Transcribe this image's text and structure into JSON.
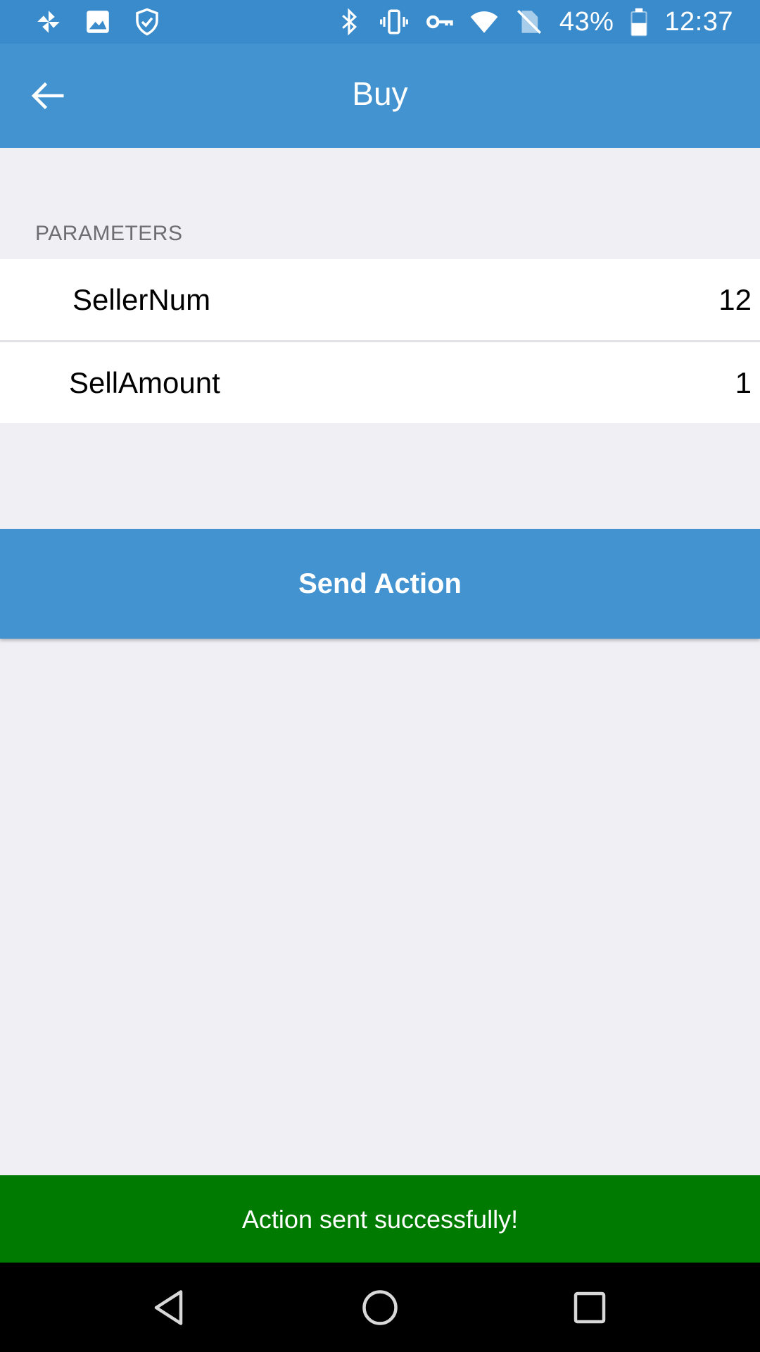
{
  "status_bar": {
    "battery_percent": "43%",
    "time": "12:37",
    "left_icons": [
      "pinwheel-icon",
      "image-icon",
      "shield-check-icon"
    ],
    "right_icons": [
      "bluetooth-icon",
      "vibrate-icon",
      "vpn-key-icon",
      "wifi-icon",
      "no-sim-icon",
      "battery-icon"
    ]
  },
  "toolbar": {
    "title": "Buy",
    "back_icon": "arrow-left-icon"
  },
  "parameters": {
    "header": "PARAMETERS",
    "items": [
      {
        "label": "SellerNum",
        "value": "12"
      },
      {
        "label": "SellAmount",
        "value": "1"
      }
    ]
  },
  "action": {
    "send_label": "Send Action"
  },
  "toast": {
    "message": "Action sent successfully!"
  },
  "nav_bar": {
    "icons": [
      "nav-back-icon",
      "nav-home-icon",
      "nav-recents-icon"
    ]
  },
  "colors": {
    "primary": "#4293d0",
    "status_bar": "#3a8bcc",
    "background": "#efeff4",
    "success": "#017a02",
    "nav_bar": "#000000"
  }
}
